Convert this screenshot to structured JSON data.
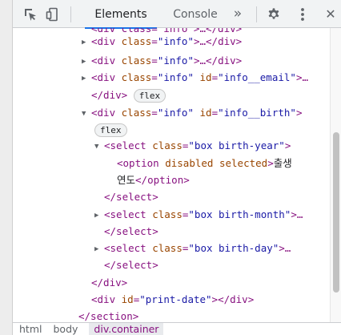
{
  "toolbar": {
    "inspect_icon": "inspect-pointer-icon",
    "device_icon": "device-toolbar-icon",
    "tabs": [
      {
        "label": "Elements",
        "active": true
      },
      {
        "label": "Console",
        "active": false
      }
    ],
    "more_tabs_icon": "double-chevron-icon",
    "more_tabs_glyph": "»",
    "settings_icon": "gear-icon",
    "menu_icon": "kebab-menu-icon",
    "close_icon": "close-icon",
    "close_glyph": "✕"
  },
  "tree": {
    "lines": [
      {
        "parts": [
          "<div class=\"info\">…</div>"
        ]
      },
      {
        "tag_open": "<div",
        "attr": "class",
        "val": "\"info\"",
        "rest": ">…</div>"
      },
      {
        "tag_open": "<div",
        "attr": "class",
        "val": "\"info\"",
        "rest": ">…</div>"
      },
      {
        "tag_open": "<div",
        "attr": "class",
        "val": "\"info\"",
        "attr2": "id",
        "val2": "\"info__email\"",
        "rest": ">…"
      },
      {
        "close": "</div>",
        "badge": "flex"
      },
      {
        "tag_open": "<div",
        "attr": "class",
        "val": "\"info\"",
        "attr2": "id",
        "val2": "\"info__birth\"",
        "rest": ">"
      },
      {
        "badge": "flex"
      },
      {
        "tag_open": "<select",
        "attr": "class",
        "val": "\"box birth-year\"",
        "rest": ">"
      },
      {
        "tag_open": "<option",
        "attr": "disabled",
        "attr2": "selected",
        "rest": ">",
        "text": "출생"
      },
      {
        "text": "연도",
        "close": "</option>"
      },
      {
        "close": "</select>"
      },
      {
        "tag_open": "<select",
        "attr": "class",
        "val": "\"box birth-month\"",
        "rest": ">…"
      },
      {
        "close": "</select>"
      },
      {
        "tag_open": "<select",
        "attr": "class",
        "val": "\"box birth-day\"",
        "rest": ">…"
      },
      {
        "close": "</select>"
      },
      {
        "close": "</div>"
      },
      {
        "tag_open": "<div",
        "attr": "id",
        "val": "\"print-date\"",
        "rest": "></div>"
      },
      {
        "close": "</section>"
      }
    ]
  },
  "breadcrumbs": [
    "html",
    "body",
    "div.container"
  ],
  "colors": {
    "accent": "#1a73e8",
    "tag": "#881280",
    "attr": "#994500",
    "value": "#1a1aa6"
  }
}
